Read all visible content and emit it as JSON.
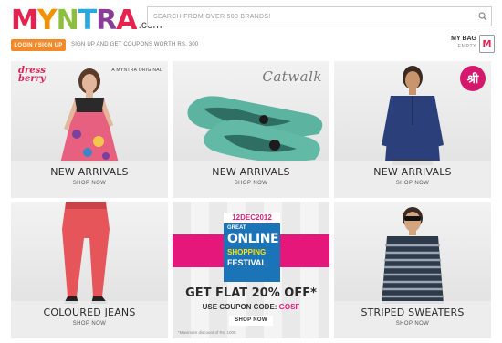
{
  "header": {
    "logo_letters": [
      "M",
      "Y",
      "N",
      "T",
      "R",
      "A"
    ],
    "logo_suffix": ".com",
    "search_placeholder": "SEARCH FROM OVER 500 BRANDS!",
    "login_label": "LOGIN / SIGN UP",
    "signup_note": "SIGN UP AND GET COUPONS WORTH RS. 300",
    "bag_label": "MY BAG",
    "bag_status": "EMPTY",
    "bag_icon_letter": "M"
  },
  "tiles": [
    {
      "title": "NEW ARRIVALS",
      "cta": "SHOP NOW",
      "brand": "dress berry",
      "badge": "A MYNTRA ORIGINAL"
    },
    {
      "title": "NEW ARRIVALS",
      "cta": "SHOP NOW",
      "brand": "Catwalk"
    },
    {
      "title": "NEW ARRIVALS",
      "cta": "SHOP NOW",
      "brand": "श्री"
    },
    {
      "title": "COLOURED JEANS",
      "cta": "SHOP NOW"
    },
    {
      "title": "STRIPED SWEATERS",
      "cta": "SHOP NOW"
    }
  ],
  "promo": {
    "date": "12DEC2012",
    "great": "GREAT",
    "online": "ONLINE",
    "shopping": "SHOPPING",
    "festival": "FESTIVAL",
    "offer": "GET FLAT 20% OFF*",
    "code_prefix": "USE COUPON CODE: ",
    "code": "GOSF",
    "cta": "SHOP NOW",
    "fine_print": "*Maximum discount of Rs. 1000"
  },
  "colors": {
    "brand_pink": "#e6224f",
    "cta_orange": "#f28a2b",
    "promo_magenta": "#e5177b",
    "promo_blue": "#1c74b8"
  }
}
